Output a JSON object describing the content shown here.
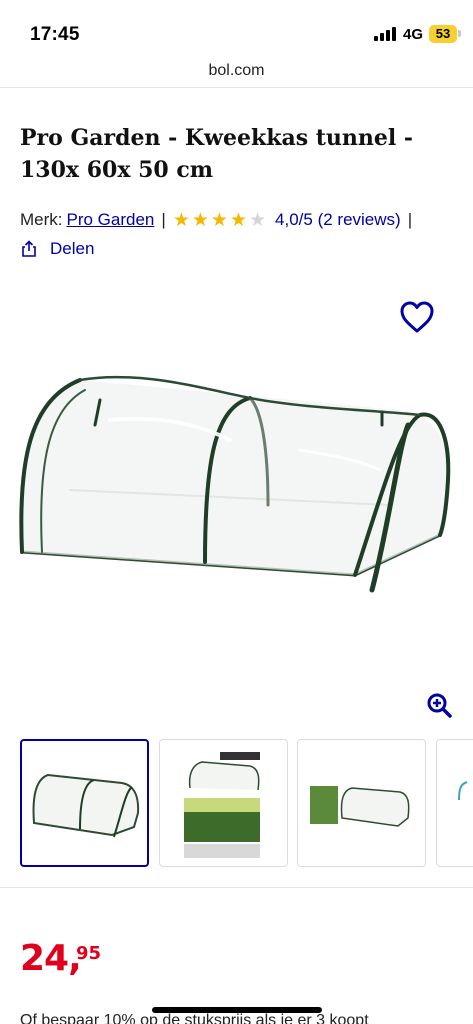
{
  "status_bar": {
    "time": "17:45",
    "network": "4G",
    "battery": "53"
  },
  "browser": {
    "url": "bol.com"
  },
  "product": {
    "title": "Pro Garden - Kweekkas tunnel - 130x 60x 50 cm",
    "brand_label": "Merk:",
    "brand": "Pro Garden",
    "separator": "|",
    "rating_value": 4,
    "rating_max": 5,
    "rating_text": "4,0/5 (2 reviews)",
    "share_label": "Delen"
  },
  "icons": {
    "favorite": "heart-outline-icon",
    "zoom": "zoom-in-icon",
    "share": "share-icon",
    "star": "star-icon"
  },
  "price": {
    "whole": "24,",
    "fraction": "95"
  },
  "promo_text": "Of bespaar 10% op de stuksprijs als je er 3 koopt",
  "colors": {
    "link": "#0000a4",
    "price": "#e0001b",
    "star": "#f5b800",
    "battery": "#f5d02e"
  }
}
